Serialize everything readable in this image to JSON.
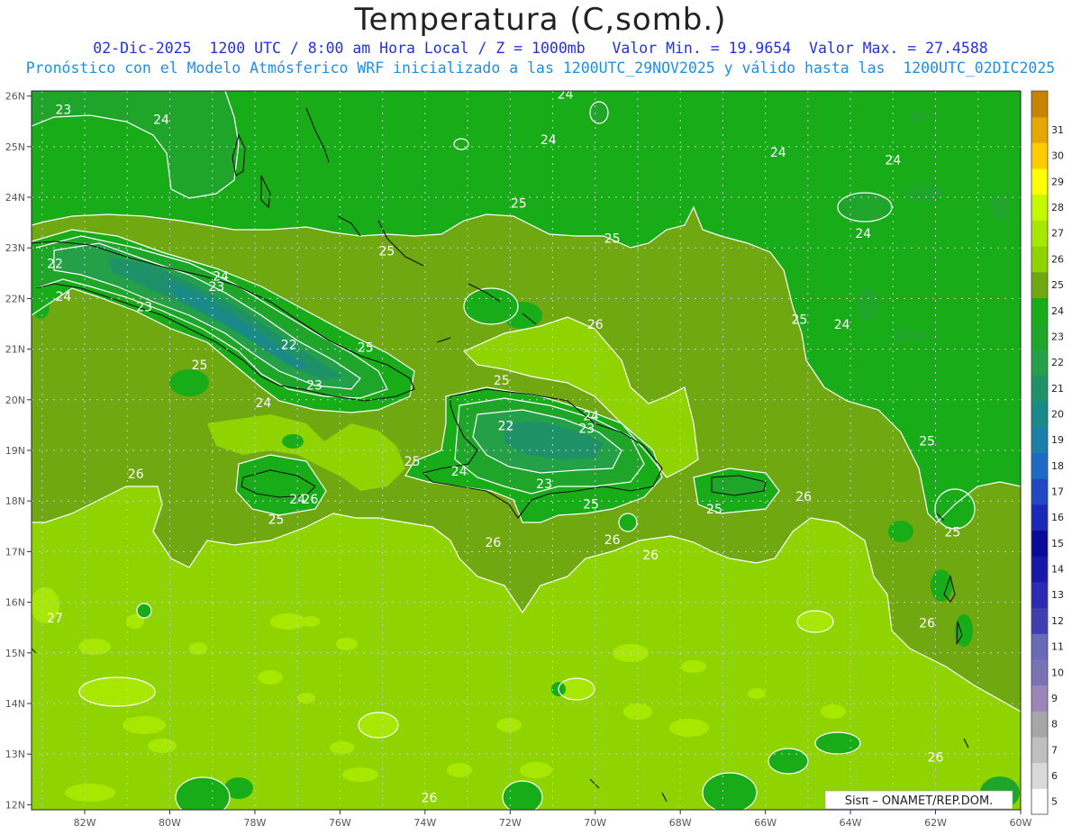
{
  "header": {
    "title": "Temperatura (C,somb.)",
    "line1": "02-Dic-2025  1200 UTC / 8:00 am Hora Local / Z = 1000mb   Valor Min. = 19.9654  Valor Max. = 27.4588",
    "line2": "Pronóstico con el Modelo Atmósferico WRF inicializado a las 1200UTC_29NOV2025 y válido hasta las  1200UTC_02DIC2025"
  },
  "map": {
    "lat_labels": [
      "26N",
      "25N",
      "24N",
      "23N",
      "22N",
      "21N",
      "20N",
      "19N",
      "18N",
      "17N",
      "16N",
      "15N",
      "14N",
      "13N",
      "12N"
    ],
    "lon_labels": [
      "82W",
      "80W",
      "78W",
      "76W",
      "74W",
      "72W",
      "70W",
      "68W",
      "66W",
      "64W",
      "62W",
      "60W"
    ],
    "contour_labels": [
      {
        "t": "23",
        "lon": -82.5,
        "lat": 25.65
      },
      {
        "t": "24",
        "lon": -80.2,
        "lat": 25.45
      },
      {
        "t": "24",
        "lon": -70.7,
        "lat": 25.95
      },
      {
        "t": "24",
        "lon": -71.1,
        "lat": 25.05
      },
      {
        "t": "24",
        "lon": -65.7,
        "lat": 24.8
      },
      {
        "t": "24",
        "lon": -63.0,
        "lat": 24.65
      },
      {
        "t": "25",
        "lon": -71.8,
        "lat": 23.8
      },
      {
        "t": "25",
        "lon": -69.6,
        "lat": 23.1
      },
      {
        "t": "24",
        "lon": -63.7,
        "lat": 23.2
      },
      {
        "t": "25",
        "lon": -74.9,
        "lat": 22.85
      },
      {
        "t": "22",
        "lon": -82.7,
        "lat": 22.6
      },
      {
        "t": "24",
        "lon": -78.8,
        "lat": 22.35
      },
      {
        "t": "23",
        "lon": -78.9,
        "lat": 22.15
      },
      {
        "t": "24",
        "lon": -82.5,
        "lat": 21.95
      },
      {
        "t": "23",
        "lon": -80.6,
        "lat": 21.75
      },
      {
        "t": "26",
        "lon": -70.0,
        "lat": 21.4
      },
      {
        "t": "25",
        "lon": -65.2,
        "lat": 21.5
      },
      {
        "t": "24",
        "lon": -64.2,
        "lat": 21.4
      },
      {
        "t": "22",
        "lon": -77.2,
        "lat": 21.0
      },
      {
        "t": "25",
        "lon": -75.4,
        "lat": 20.95
      },
      {
        "t": "25",
        "lon": -79.3,
        "lat": 20.6
      },
      {
        "t": "25",
        "lon": -72.2,
        "lat": 20.3
      },
      {
        "t": "23",
        "lon": -76.6,
        "lat": 20.2
      },
      {
        "t": "24",
        "lon": -77.8,
        "lat": 19.85
      },
      {
        "t": "24",
        "lon": -70.1,
        "lat": 19.6
      },
      {
        "t": "22",
        "lon": -72.1,
        "lat": 19.4
      },
      {
        "t": "23",
        "lon": -70.2,
        "lat": 19.35
      },
      {
        "t": "25",
        "lon": -62.2,
        "lat": 19.1
      },
      {
        "t": "25",
        "lon": -74.3,
        "lat": 18.7
      },
      {
        "t": "24",
        "lon": -73.2,
        "lat": 18.5
      },
      {
        "t": "26",
        "lon": -80.8,
        "lat": 18.45
      },
      {
        "t": "23",
        "lon": -71.2,
        "lat": 18.25
      },
      {
        "t": "24",
        "lon": -77.0,
        "lat": 17.95
      },
      {
        "t": "26",
        "lon": -76.7,
        "lat": 17.95
      },
      {
        "t": "26",
        "lon": -65.1,
        "lat": 18.0
      },
      {
        "t": "25",
        "lon": -70.1,
        "lat": 17.85
      },
      {
        "t": "25",
        "lon": -67.2,
        "lat": 17.75
      },
      {
        "t": "25",
        "lon": -77.5,
        "lat": 17.55
      },
      {
        "t": "26",
        "lon": -69.6,
        "lat": 17.15
      },
      {
        "t": "26",
        "lon": -72.4,
        "lat": 17.1
      },
      {
        "t": "25",
        "lon": -61.6,
        "lat": 17.3
      },
      {
        "t": "26",
        "lon": -68.7,
        "lat": 16.85
      },
      {
        "t": "27",
        "lon": -82.7,
        "lat": 15.6
      },
      {
        "t": "26",
        "lon": -62.2,
        "lat": 15.5
      },
      {
        "t": "26",
        "lon": -62.0,
        "lat": 12.85
      },
      {
        "t": "26",
        "lon": -73.9,
        "lat": 12.05
      }
    ],
    "credit": "Sisπ – ONAMET/REP.DOM."
  },
  "colorbar": {
    "labels": [
      "5",
      "6",
      "7",
      "8",
      "9",
      "10",
      "11",
      "12",
      "13",
      "14",
      "15",
      "16",
      "17",
      "18",
      "19",
      "20",
      "21",
      "22",
      "23",
      "24",
      "25",
      "26",
      "27",
      "28",
      "29",
      "30",
      "31"
    ],
    "colors": [
      "#ffffff",
      "#d9d9d9",
      "#bfbfbf",
      "#a6a6a6",
      "#9a86b8",
      "#7a72b5",
      "#6a6ab8",
      "#3e3eb0",
      "#2a2ab2",
      "#1818a8",
      "#0a0a9a",
      "#1a28b5",
      "#1f48c2",
      "#1c6ac4",
      "#1c7fa8",
      "#1a8a88",
      "#1e9168",
      "#24a048",
      "#1ea52a",
      "#18ad18",
      "#6fa810",
      "#8fd400",
      "#a8e800",
      "#c6f800",
      "#ffff00",
      "#ffcc00",
      "#e6a800",
      "#c88400"
    ]
  }
}
